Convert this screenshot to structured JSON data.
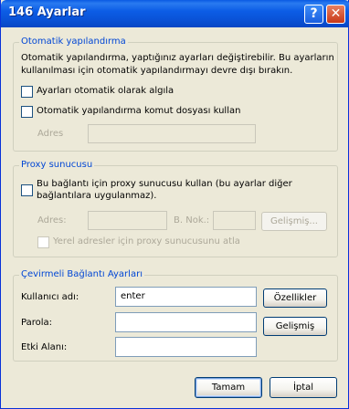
{
  "window": {
    "title": "146 Ayarlar"
  },
  "titlebar": {
    "help_glyph": "?",
    "close_glyph": "✕"
  },
  "auto_config": {
    "legend": "Otomatik yapılandırma",
    "description_line1": "Otomatik yapılandırma, yaptığınız ayarları değiştirebilir. Bu ayarların",
    "description_line2": "kullanılması için otomatik yapılandırmayı devre dışı bırakın.",
    "auto_detect_label": "Ayarları otomatik olarak algıla",
    "auto_detect_checked": false,
    "use_script_label": "Otomatik yapılandırma komut dosyası kullan",
    "use_script_checked": false,
    "address_label": "Adres",
    "address_value": ""
  },
  "proxy": {
    "legend": "Proxy sunucusu",
    "use_proxy_line1": "Bu bağlantı için proxy sunucusu kullan (bu ayarlar diğer",
    "use_proxy_line2": "bağlantılara uygulanmaz).",
    "use_proxy_checked": false,
    "address_label": "Adres:",
    "address_value": "",
    "port_label": "B. Nok.:",
    "port_value": "",
    "advanced_label": "Gelişmiş...",
    "bypass_label": "Yerel adresler için proxy sunucusunu atla",
    "bypass_checked": false
  },
  "dialup": {
    "legend": "Çevirmeli Bağlantı Ayarları",
    "username_label": "Kullanıcı adı:",
    "username_value": "enter",
    "properties_label": "Özellikler",
    "password_label": "Parola:",
    "password_value": "",
    "advanced_label": "Gelişmiş",
    "domain_label": "Etki Alanı:",
    "domain_value": ""
  },
  "footer": {
    "ok_label": "Tamam",
    "cancel_label": "İptal"
  }
}
